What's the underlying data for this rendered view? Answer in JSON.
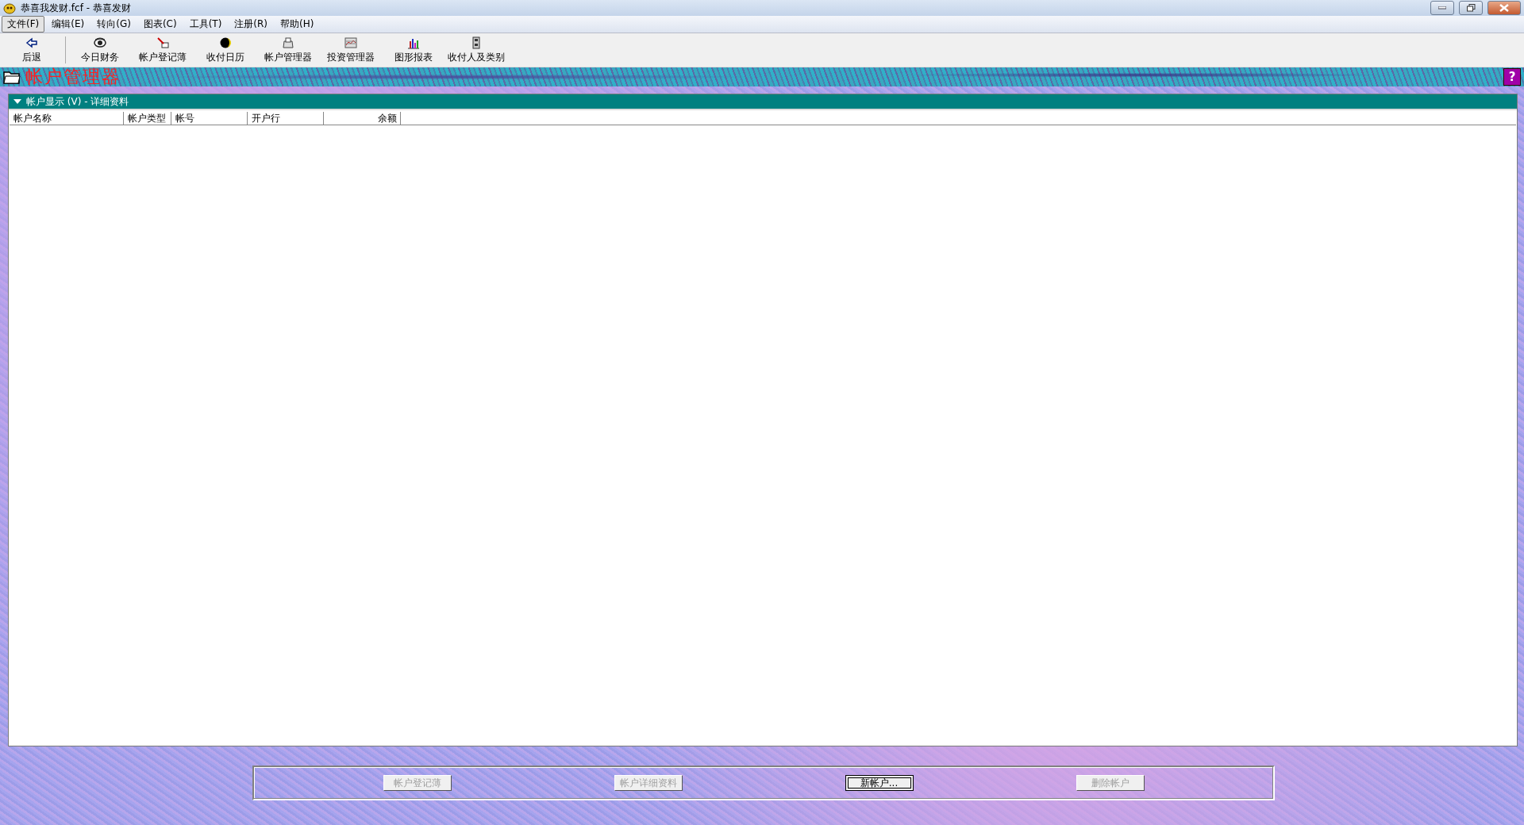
{
  "window": {
    "title": "恭喜我发财.fcf - 恭喜发财"
  },
  "menu": [
    {
      "label": "文件(F)",
      "selected": true
    },
    {
      "label": "编辑(E)",
      "selected": false
    },
    {
      "label": "转向(G)",
      "selected": false
    },
    {
      "label": "图表(C)",
      "selected": false
    },
    {
      "label": "工具(T)",
      "selected": false
    },
    {
      "label": "注册(R)",
      "selected": false
    },
    {
      "label": "帮助(H)",
      "selected": false
    }
  ],
  "toolbar": [
    {
      "label": "后退"
    },
    {
      "label": "今日财务"
    },
    {
      "label": "帐户登记薄"
    },
    {
      "label": "收付日历"
    },
    {
      "label": "帐户管理器"
    },
    {
      "label": "投资管理器"
    },
    {
      "label": "图形报表"
    },
    {
      "label": "收付人及类别"
    }
  ],
  "banner": {
    "title": "帐户管理器",
    "help": "?"
  },
  "panel": {
    "title": "帐户显示 (V) - 详细资料",
    "expanded": true,
    "columns": [
      {
        "label": "帐户名称",
        "kind": "text"
      },
      {
        "label": "帐户类型",
        "kind": "text"
      },
      {
        "label": "帐号",
        "kind": "text"
      },
      {
        "label": "开户行",
        "kind": "text"
      },
      {
        "label": "余额",
        "kind": "amount"
      }
    ]
  },
  "buttons": [
    {
      "label": "帐户登记薄",
      "disabled": true
    },
    {
      "label": "帐户详细资料",
      "disabled": true
    },
    {
      "label": "新帐户...",
      "disabled": false
    },
    {
      "label": "删除帐户",
      "disabled": true
    }
  ]
}
